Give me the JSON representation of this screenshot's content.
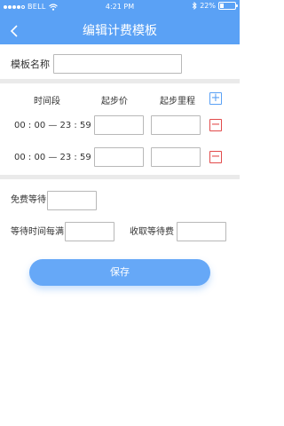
{
  "status_bar": {
    "carrier": "BELL",
    "time": "4:21 PM",
    "battery": "22%"
  },
  "nav": {
    "title": "编辑计费模板"
  },
  "template_name": {
    "label": "模板名称",
    "value": ""
  },
  "table": {
    "headers": {
      "time_period": "时间段",
      "start_price": "起步价",
      "start_distance": "起步里程"
    },
    "rows": [
      {
        "time_range": "00 : 00  — 23 : 59",
        "start_price": "",
        "start_distance": ""
      },
      {
        "time_range": "00 : 00  — 23 : 59",
        "start_price": "",
        "start_distance": ""
      }
    ],
    "add_symbol": "+",
    "remove_symbol": "−"
  },
  "free_wait": {
    "label": "免费等待",
    "value": ""
  },
  "wait_every": {
    "label": "等待时间每满",
    "value": ""
  },
  "wait_fee": {
    "label": "收取等待费",
    "value": ""
  },
  "save_label": "保存",
  "colors": {
    "primary": "#5aa1f5",
    "danger": "#e24b4b",
    "divider": "#eaeaea"
  },
  "icons": [
    "wifi-icon",
    "bluetooth-icon",
    "battery-icon",
    "back-arrow-icon",
    "plus-icon",
    "minus-icon"
  ]
}
